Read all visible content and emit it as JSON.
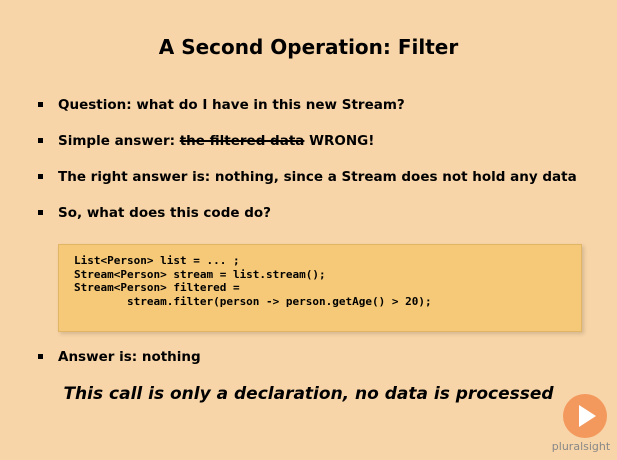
{
  "slide": {
    "title": "A Second Operation: Filter",
    "bullets": [
      {
        "text": "Question: what do I have in this new Stream?"
      },
      {
        "prefix": "Simple answer: ",
        "strike": "the filtered data",
        "suffix": " WRONG!"
      },
      {
        "text": "The right answer is: nothing, since a Stream does not hold any data"
      },
      {
        "text": "So, what does this code do?"
      }
    ],
    "code": "List<Person> list = ... ;\nStream<Person> stream = list.stream();\nStream<Person> filtered =\n        stream.filter(person -> person.getAge() > 20);",
    "answer": "Answer is: nothing",
    "conclusion": "This call is only a declaration, no data is processed",
    "brand": "pluralsight"
  },
  "colors": {
    "background": "#f8d5a8",
    "code_background": "#f5c978",
    "logo": "#f18a4a"
  }
}
